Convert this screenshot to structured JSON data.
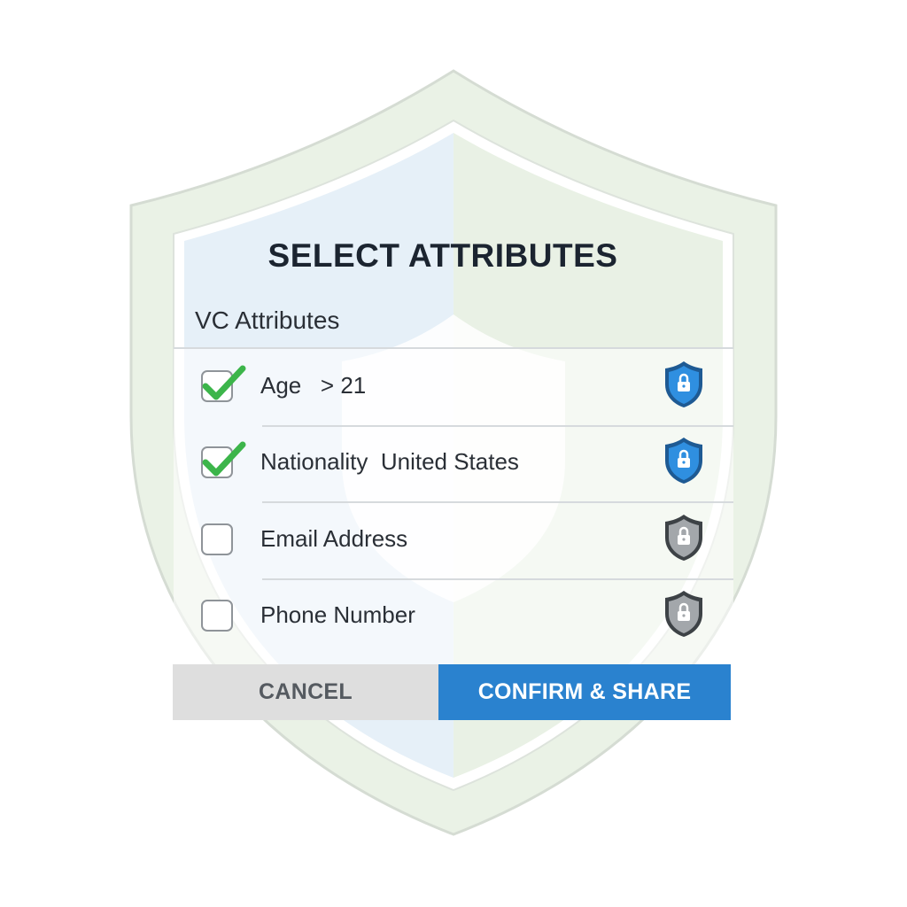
{
  "dialog": {
    "title": "SELECT ATTRIBUTES",
    "section_label": "VC Attributes"
  },
  "attributes": [
    {
      "label": "Age   > 21",
      "checked": true,
      "shield_state": "locked-active",
      "icon": "lock-shield-icon"
    },
    {
      "label": "Nationality  United States",
      "checked": true,
      "shield_state": "locked-active",
      "icon": "lock-shield-icon"
    },
    {
      "label": "Email Address",
      "checked": false,
      "shield_state": "locked-inactive",
      "icon": "lock-shield-icon"
    },
    {
      "label": "Phone Number",
      "checked": false,
      "shield_state": "locked-inactive",
      "icon": "lock-shield-icon"
    }
  ],
  "buttons": {
    "cancel_label": "CANCEL",
    "confirm_label": "CONFIRM & SHARE"
  },
  "colors": {
    "accent_blue": "#2a82cf",
    "check_green": "#3cb54a",
    "lock_active": "#2a82cf",
    "lock_inactive": "#9a9ea3",
    "cancel_bg": "#dedede"
  }
}
